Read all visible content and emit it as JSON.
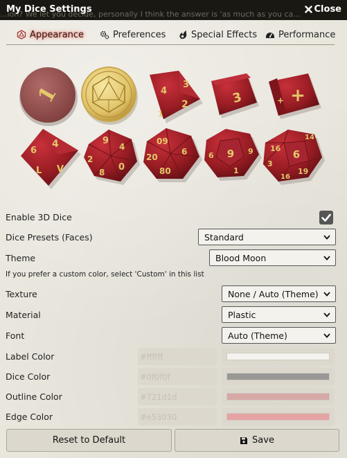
{
  "window": {
    "title": "My Dice Settings",
    "ghost_text": "...ion? We let you decide, personally I think the answer is 'as much as you ca...",
    "close_label": "Close"
  },
  "tabs": [
    {
      "label": "Appearance",
      "icon": "d20-icon",
      "active": true
    },
    {
      "label": "Preferences",
      "icon": "gears-icon",
      "active": false
    },
    {
      "label": "Special Effects",
      "icon": "flame-icon",
      "active": false
    },
    {
      "label": "Performance",
      "icon": "gauge-icon",
      "active": false
    }
  ],
  "dice": [
    {
      "type": "d2",
      "face": "1"
    },
    {
      "type": "d100",
      "face": ""
    },
    {
      "type": "d4",
      "face": "2"
    },
    {
      "type": "d6",
      "face": "3"
    },
    {
      "type": "dF",
      "face": "+"
    },
    {
      "type": "d4",
      "face": "4"
    },
    {
      "type": "d8",
      "face": "9"
    },
    {
      "type": "d10",
      "face": "09"
    },
    {
      "type": "d12",
      "face": "9"
    },
    {
      "type": "d20",
      "face": "6"
    }
  ],
  "form": {
    "enable3d_label": "Enable 3D Dice",
    "enable3d_checked": true,
    "presets_label": "Dice Presets (Faces)",
    "presets_value": "Standard",
    "theme_label": "Theme",
    "theme_value": "Blood Moon",
    "theme_hint": "If you prefer a custom color, select 'Custom' in this list",
    "texture_label": "Texture",
    "texture_value": "None / Auto (Theme)",
    "material_label": "Material",
    "material_value": "Plastic",
    "font_label": "Font",
    "font_value": "Auto (Theme)",
    "label_color_label": "Label Color",
    "label_color_value": "#ffffff",
    "dice_color_label": "Dice Color",
    "dice_color_value": "#0f0f0f",
    "outline_color_label": "Outline Color",
    "outline_color_value": "#721d1d",
    "edge_color_label": "Edge Color",
    "edge_color_value": "#e53030"
  },
  "swatches": {
    "label": "#f4f2ee",
    "dice": "#9a9895",
    "outline": "#d6a8a6",
    "edge": "#e5a3a3"
  },
  "buttons": {
    "reset_label": "Reset to Default",
    "save_label": "Save"
  },
  "colors": {
    "titlebar": "#191813",
    "die_red": "#9e1f26",
    "die_gold": "#e4c86a",
    "tab_glow": "#ff5a4a"
  }
}
